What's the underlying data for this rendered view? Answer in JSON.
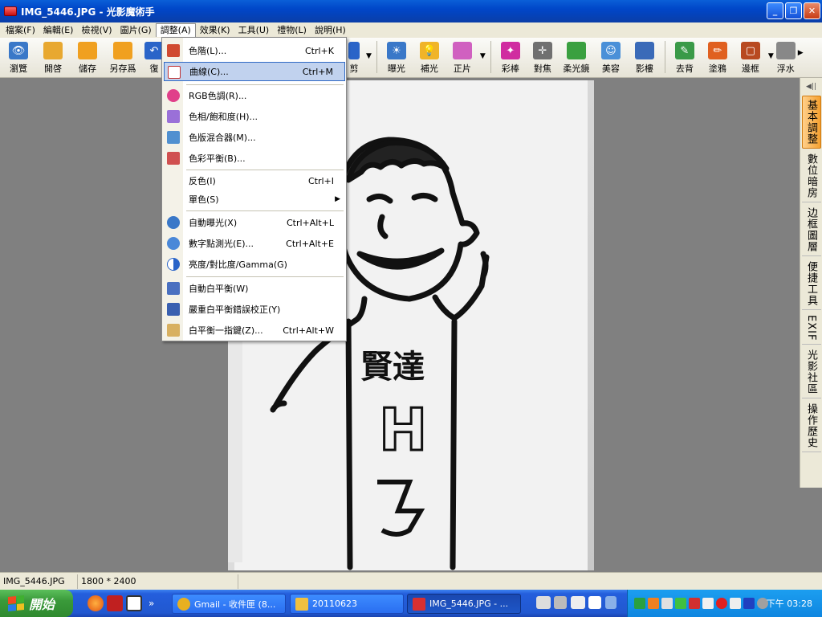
{
  "window": {
    "title": "IMG_5446.JPG - 光影魔術手",
    "min_label": "_",
    "max_label": "❐",
    "close_label": "✕"
  },
  "menubar": [
    "檔案(F)",
    "編輯(E)",
    "檢視(V)",
    "圖片(G)",
    "調整(A)",
    "效果(K)",
    "工具(U)",
    "禮物(L)",
    "說明(H)"
  ],
  "toolbar": {
    "left": [
      {
        "label": "瀏覽",
        "icon": "browse-icon",
        "color": "#3a78c8"
      },
      {
        "label": "開啓",
        "icon": "open-folder-icon",
        "color": "#e8a830"
      },
      {
        "label": "儲存",
        "icon": "save-icon",
        "color": "#f0a020"
      },
      {
        "label": "另存爲",
        "icon": "save-as-icon",
        "color": "#f0a020"
      },
      {
        "label": "復",
        "icon": "undo-icon",
        "color": "#2a64c8"
      }
    ],
    "partial_right_label": "剪",
    "right": [
      {
        "label": "曝光",
        "icon": "exposure-icon",
        "color": "#3a78c8"
      },
      {
        "label": "補光",
        "icon": "fill-light-icon",
        "color": "#f0b428"
      },
      {
        "label": "正片",
        "icon": "positive-film-icon",
        "color": "#d060c0"
      },
      {
        "label": "彩棒",
        "icon": "color-wand-icon",
        "color": "#d02ca0"
      },
      {
        "label": "對焦",
        "icon": "focus-icon",
        "color": "#707070"
      },
      {
        "label": "柔光鏡",
        "icon": "soft-light-icon",
        "color": "#3aa040"
      },
      {
        "label": "美容",
        "icon": "beauty-icon",
        "color": "#4a90d8"
      },
      {
        "label": "影樓",
        "icon": "studio-icon",
        "color": "#3a6ab8"
      },
      {
        "label": "去背",
        "icon": "remove-background-icon",
        "color": "#3a9a48"
      },
      {
        "label": "塗鴉",
        "icon": "doodle-icon",
        "color": "#e06020"
      },
      {
        "label": "邊框",
        "icon": "frame-icon",
        "color": "#b84a20"
      },
      {
        "label": "浮水",
        "icon": "watermark-icon",
        "color": "#888888"
      }
    ]
  },
  "adjust_menu": {
    "items": [
      {
        "label": "色階(L)...",
        "shortcut": "Ctrl+K",
        "icon": "levels-icon",
        "color": "#d04a30"
      },
      {
        "label": "曲線(C)...",
        "shortcut": "Ctrl+M",
        "icon": "curves-icon",
        "color": "#c03030"
      },
      {
        "label": "RGB色調(R)...",
        "shortcut": "",
        "icon": "rgb-tone-icon",
        "color": "#e0408a"
      },
      {
        "label": "色相/飽和度(H)...",
        "shortcut": "",
        "icon": "hue-saturation-icon",
        "color": "#9a70d8"
      },
      {
        "label": "色版混合器(M)...",
        "shortcut": "",
        "icon": "channel-mixer-icon",
        "color": "#5090d0"
      },
      {
        "label": "色彩平衡(B)...",
        "shortcut": "",
        "icon": "color-balance-icon",
        "color": "#d05050"
      },
      {
        "label": "反色(I)",
        "shortcut": "Ctrl+I",
        "icon": "",
        "color": ""
      },
      {
        "label": "單色(S)",
        "shortcut": "",
        "icon": "",
        "color": "",
        "submenu": "▶"
      },
      {
        "label": "自動曝光(X)",
        "shortcut": "Ctrl+Alt+L",
        "icon": "auto-exposure-icon",
        "color": "#3a78c8"
      },
      {
        "label": "數字點測光(E)...",
        "shortcut": "Ctrl+Alt+E",
        "icon": "spot-metering-icon",
        "color": "#4a88d8"
      },
      {
        "label": "亮度/對比度/Gamma(G)",
        "shortcut": "",
        "icon": "brightness-contrast-icon",
        "color": "#2a64c8"
      },
      {
        "label": "自動白平衡(W)",
        "shortcut": "",
        "icon": "auto-white-balance-icon",
        "color": "#4a70c0"
      },
      {
        "label": "嚴重白平衡錯誤校正(Y)",
        "shortcut": "",
        "icon": "white-balance-correction-icon",
        "color": "#3a60b0"
      },
      {
        "label": "白平衡一指鍵(Z)...",
        "shortcut": "Ctrl+Alt+W",
        "icon": "one-click-white-balance-icon",
        "color": "#d8b060"
      }
    ]
  },
  "side_panel": {
    "collapse": "◀||",
    "tabs": [
      "基本調整",
      "數位暗房",
      "边框圖層",
      "便捷工具",
      "EXIF",
      "光影社區",
      "操作歷史"
    ]
  },
  "photo": {
    "drawing_text": "賢達"
  },
  "statusbar": {
    "filename": "IMG_5446.JPG",
    "dimensions": "1800 * 2400"
  },
  "taskbar": {
    "start_label": "開始",
    "expand": "»",
    "tasks": [
      {
        "label": "Gmail - 收件匣 (8...",
        "icon": "chrome-icon",
        "color": "#e8b020"
      },
      {
        "label": "20110623",
        "icon": "folder-icon",
        "color": "#f0c040"
      },
      {
        "label": "IMG_5446.JPG - ...",
        "icon": "app-icon",
        "color": "#d83030"
      }
    ],
    "clock": "下午 03:28"
  }
}
